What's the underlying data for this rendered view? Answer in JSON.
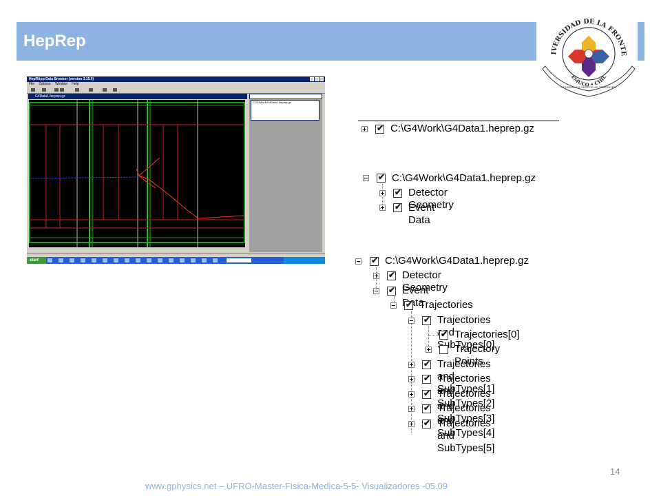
{
  "slide": {
    "title": "HepRep",
    "page_number": "14",
    "footer": "www.gphysics.net – UFRO-Master-Fisica-Medica-5-5- Visualizadores -05.09",
    "accent_color": "#8db3e2"
  },
  "logo": {
    "text_top": "UNIVERSIDAD DE LA FRONTERA",
    "text_city": "TEMUCO • CHILE",
    "motto": "GENERAMUS MENTIS AD VERITATEM"
  },
  "app": {
    "window_title": "HepRApp Data Browser (version 3.15.0)",
    "menu": [
      "File",
      "Options",
      "Window",
      "Help"
    ],
    "viewer_title": "G4Data1.heprep.gz",
    "tree_item": "C:\\G4Work\\G4Data1.heprep.gz",
    "taskbar_start": "start"
  },
  "tree_collapsed": {
    "root": "C:\\G4Work\\G4Data1.heprep.gz"
  },
  "tree_expanded": {
    "root": "C:\\G4Work\\G4Data1.heprep.gz",
    "children": [
      "Detector Geometry",
      "Event Data"
    ]
  },
  "tree_full": {
    "root": "C:\\G4Work\\G4Data1.heprep.gz",
    "detector": "Detector Geometry",
    "event": "Event Data",
    "trajectories": "Trajectories",
    "subtype0": "Trajectories and SubTypes[0]",
    "traj0": "Trajectories[0]",
    "traj_points": "Trajectory Points",
    "subtype1": "Trajectories and SubTypes[1]",
    "subtype2": "Trajectories and SubTypes[2]",
    "subtype3": "Trajectories and SubTypes[3]",
    "subtype4": "Trajectories and SubTypes[4]",
    "subtype5": "Trajectories and SubTypes[5]"
  }
}
